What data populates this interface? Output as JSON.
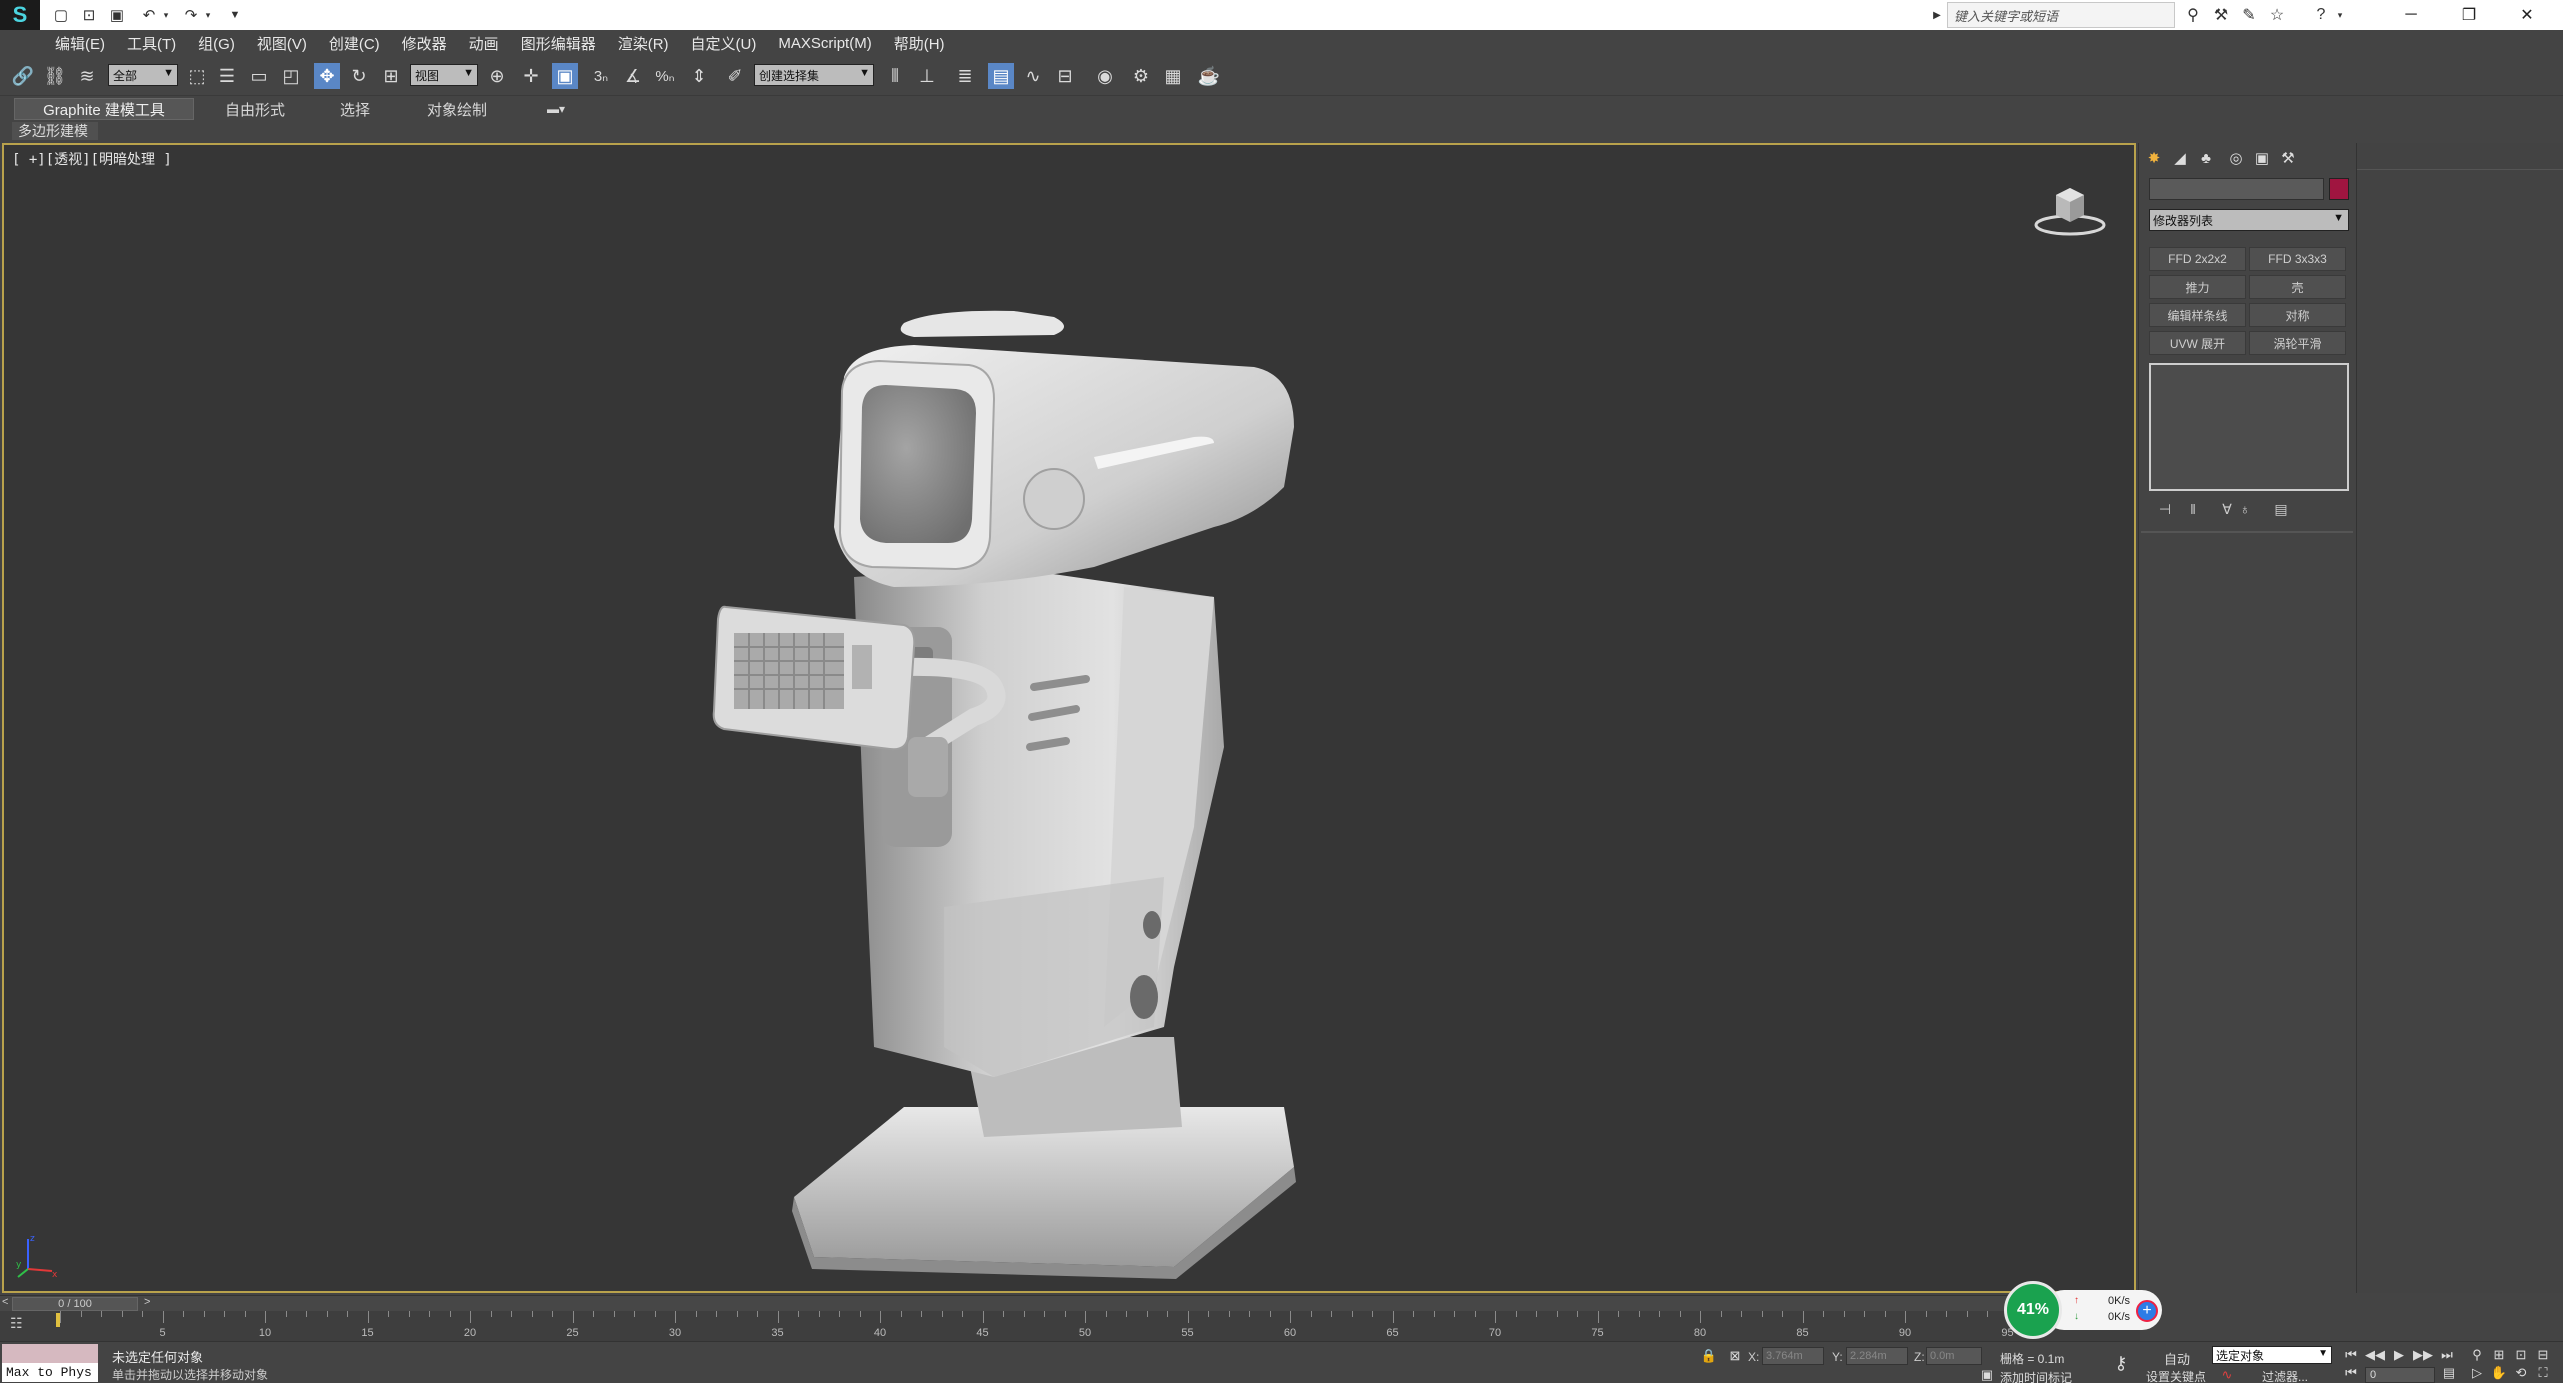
{
  "title_bar": {
    "search_placeholder": "键入关键字或短语"
  },
  "menu": {
    "items": [
      "编辑(E)",
      "工具(T)",
      "组(G)",
      "视图(V)",
      "创建(C)",
      "修改器",
      "动画",
      "图形编辑器",
      "渲染(R)",
      "自定义(U)",
      "MAXScript(M)",
      "帮助(H)"
    ]
  },
  "toolbar": {
    "selection_filter": "全部",
    "reference_coord": "视图",
    "named_selection": "创建选择集"
  },
  "ribbon": {
    "tabs": [
      "Graphite 建模工具",
      "自由形式",
      "选择",
      "对象绘制"
    ],
    "panel_label": "多边形建模"
  },
  "viewport": {
    "label": "[ +][透视][明暗处理 ]",
    "border_color": "#b9a24c"
  },
  "command_panel": {
    "object_color": "#a01540",
    "modifier_list": "修改器列表",
    "modifier_buttons": [
      "FFD 2x2x2",
      "FFD 3x3x3",
      "推力",
      "壳",
      "编辑样条线",
      "对称",
      "UVW 展开",
      "涡轮平滑"
    ]
  },
  "timeline": {
    "frame_display": "0 / 100",
    "ticks": [
      "5",
      "10",
      "15",
      "20",
      "25",
      "30",
      "35",
      "40",
      "45",
      "50",
      "55",
      "60",
      "65",
      "70",
      "75",
      "80",
      "85",
      "90",
      "95"
    ]
  },
  "status": {
    "maxscript_label": "Max to Phys",
    "line1": "未选定任何对象",
    "line2": "单击并拖动以选择并移动对象",
    "x_value": "3.764m",
    "y_value": "2.284m",
    "z_value": "0.0m",
    "x_label": "X:",
    "y_label": "Y:",
    "z_label": "Z:",
    "grid": "栅格 = 0.1m",
    "add_time_tag": "添加时间标记",
    "auto_label": "自动",
    "selection_combo": "选定对象",
    "set_key_label": "设置关键点",
    "filters_label": "过滤器...",
    "current_frame": "0"
  },
  "network_monitor": {
    "percent": "41%",
    "upload": "0K/s",
    "download": "0K/s"
  }
}
